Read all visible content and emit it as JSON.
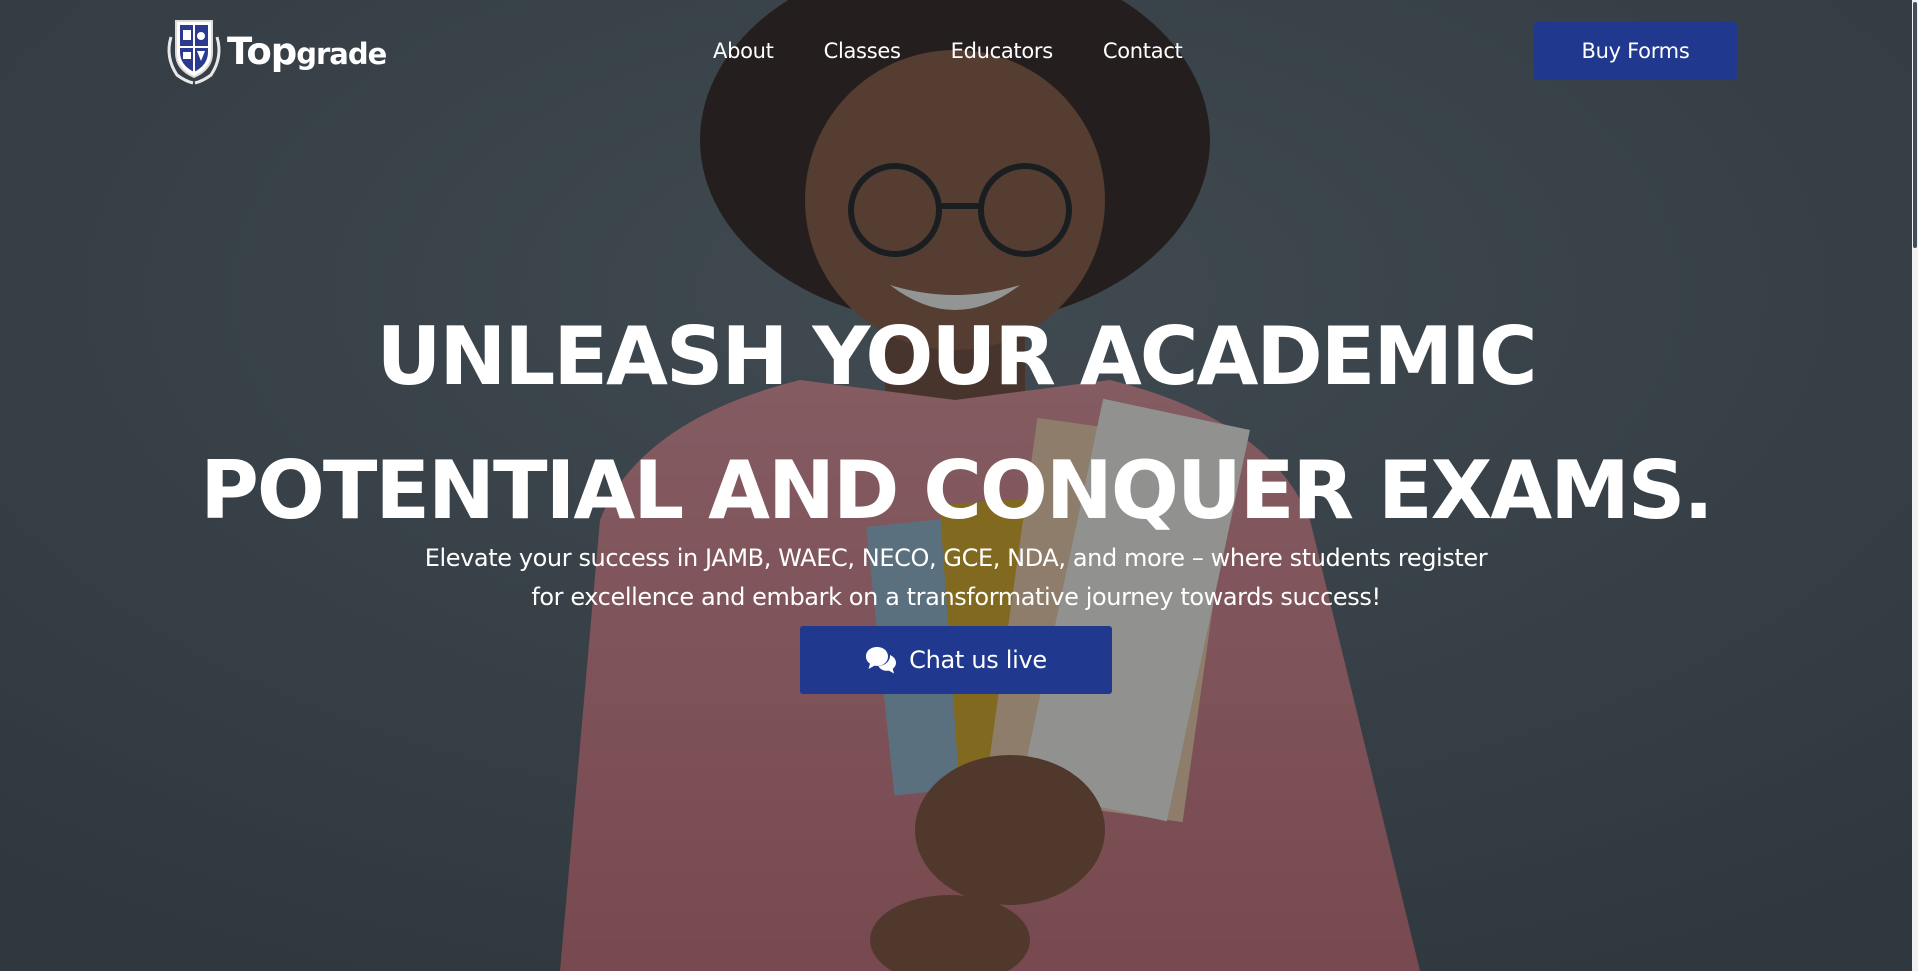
{
  "brand": {
    "name_bold": "Top",
    "name_rest": "grade",
    "crest_icon": "shield-crest-icon"
  },
  "nav": {
    "items": [
      {
        "label": "About"
      },
      {
        "label": "Classes"
      },
      {
        "label": "Educators"
      },
      {
        "label": "Contact"
      }
    ]
  },
  "header": {
    "cta_label": "Buy Forms"
  },
  "hero": {
    "headline_line1": "UNLEASH YOUR ACADEMIC",
    "headline_line2": "POTENTIAL AND CONQUER EXAMS.",
    "subtext_line1": "Elevate your success in JAMB, WAEC, NECO, GCE, NDA, and more – where students register",
    "subtext_line2": "for excellence and embark on a transformative journey towards success!",
    "chat_label": "Chat us live",
    "chat_icon": "chat-bubbles-icon"
  },
  "colors": {
    "primary": "#20398f",
    "text_on_dark": "#ffffff",
    "overlay": "#1c242a"
  }
}
